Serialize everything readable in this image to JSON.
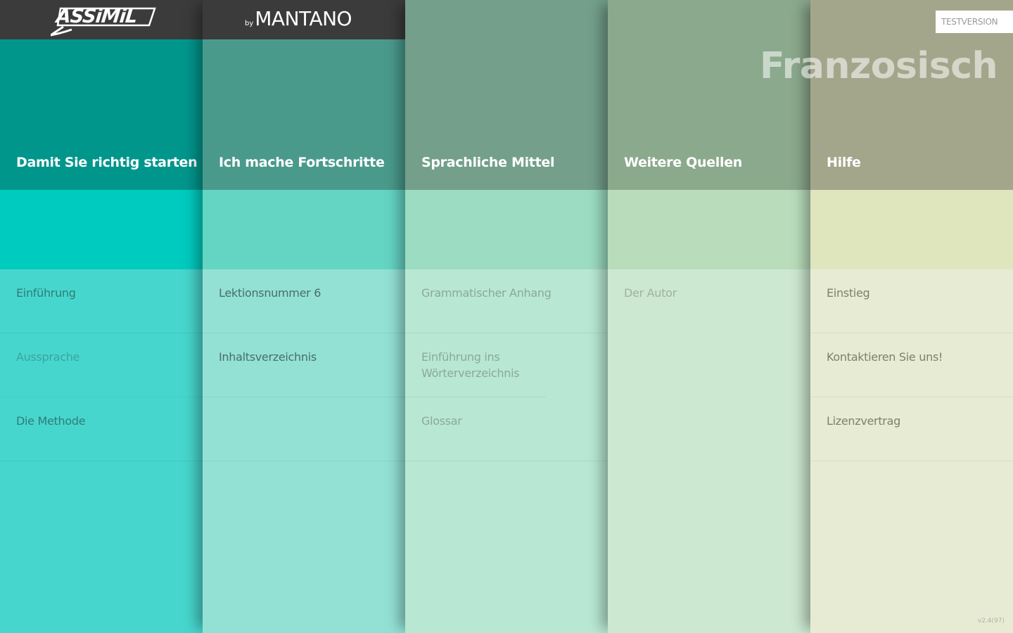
{
  "branding": {
    "assimil_logo": "ASSiMiL",
    "mantano_by": "by",
    "mantano_name": "MANTANO"
  },
  "app_title": "Franzosisch",
  "trial_badge": "TESTVERSION",
  "version": "v2.4(97)",
  "columns": [
    {
      "heading": "Damit Sie richtig starten ...",
      "colors": {
        "top": "#3b3b3b",
        "header": "#00968c",
        "mid": "#00cbbf",
        "body": "#47d6cd",
        "text": "#2f7d78"
      },
      "items": [
        "Einführung",
        "Aussprache",
        "Die Methode"
      ]
    },
    {
      "heading": "Ich mache Fortschritte",
      "colors": {
        "top": "#3b3b3b",
        "header": "#4a9a8c",
        "mid": "#64d4c3",
        "body": "#93e1d5",
        "text": "#4a6e68"
      },
      "items": [
        "Lektionsnummer 6",
        "Inhaltsverzeichnis"
      ]
    },
    {
      "heading": "Sprachliche Mittel",
      "colors": {
        "top": "#739f8b",
        "header": "#739f8b",
        "mid": "#9bdcc2",
        "body": "#b8e7d3",
        "text": "#8aa99b"
      },
      "items": [
        "Grammatischer Anhang",
        "Einführung ins Wörterverzeichnis",
        "Glossar"
      ]
    },
    {
      "heading": "Weitere Quellen",
      "colors": {
        "top": "#8ba98c",
        "header": "#8ba98c",
        "mid": "#b9ddbb",
        "body": "#cce8d1",
        "text": "#9cb3a0"
      },
      "items": [
        "Der Autor"
      ]
    },
    {
      "heading": "Hilfe",
      "colors": {
        "top": "#a4a68b",
        "header": "#a4a68b",
        "mid": "#dfe5bd",
        "body": "#e8ebd3",
        "text": "#7d806a"
      },
      "items": [
        "Einstieg",
        "Kontaktieren Sie uns!",
        "Lizenzvertrag"
      ]
    }
  ]
}
